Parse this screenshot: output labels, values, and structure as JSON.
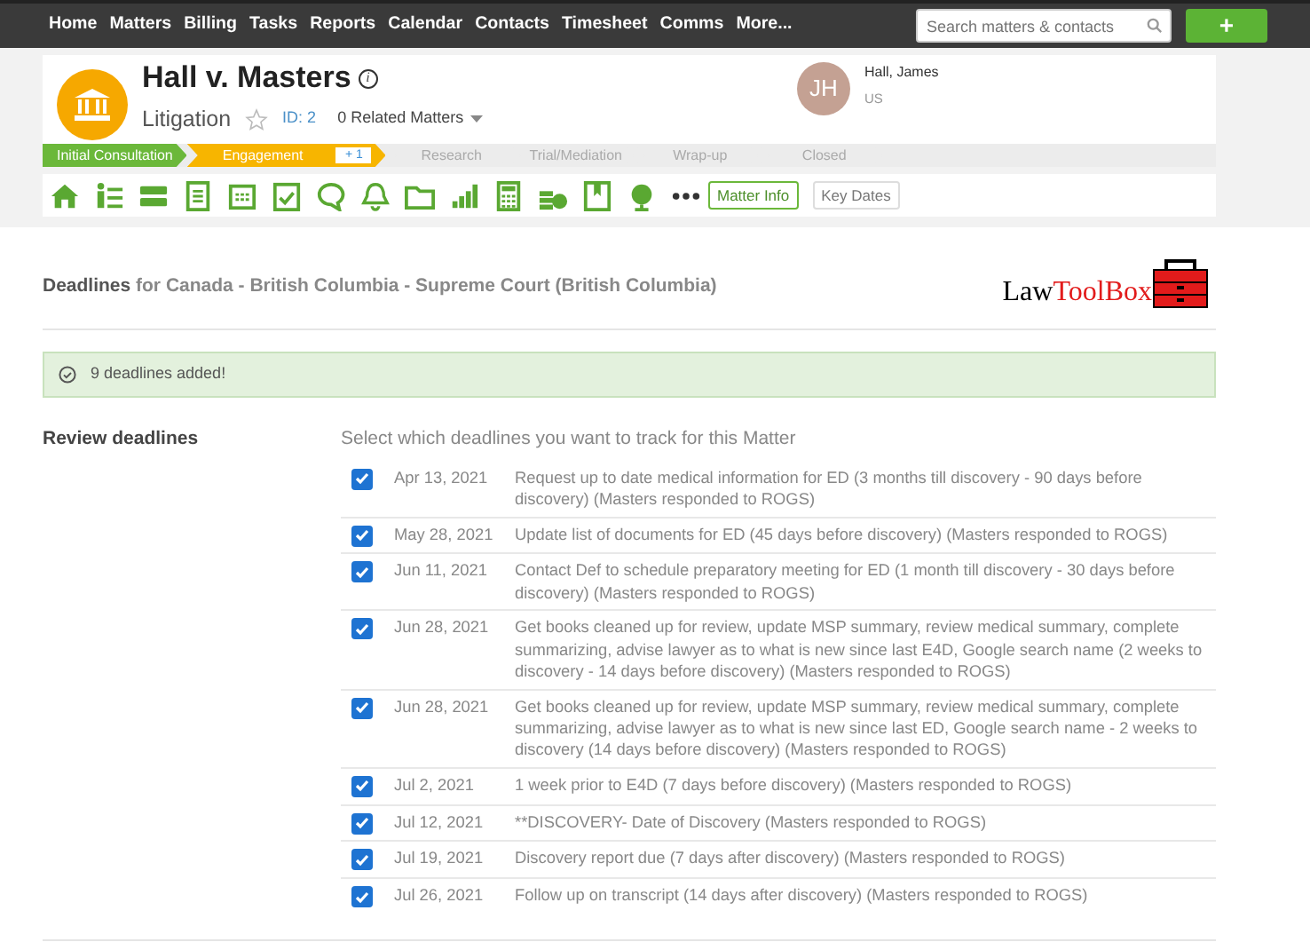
{
  "nav": {
    "items": [
      "Home",
      "Matters",
      "Billing",
      "Tasks",
      "Reports",
      "Calendar",
      "Contacts",
      "Timesheet",
      "Comms",
      "More..."
    ],
    "search": {
      "placeholder": "Search matters & contacts"
    },
    "add_button": "+"
  },
  "matter": {
    "title": "Hall v. Masters",
    "info_icon": "i",
    "type": "Litigation",
    "starred": false,
    "id": "ID: 2",
    "related": "0 Related Matters",
    "client": {
      "initials": "JH",
      "name": "Hall, James",
      "location": "US"
    },
    "stages": [
      {
        "label": "Initial Consultation",
        "completed": true,
        "selected": false
      },
      {
        "label": "Engagement",
        "completed": false,
        "selected": true,
        "badge": "+ 1"
      },
      {
        "label": "Research",
        "completed": false,
        "selected": false
      },
      {
        "label": "Trial/Mediation",
        "completed": false,
        "selected": false
      },
      {
        "label": "Wrap-up",
        "completed": false,
        "selected": false
      },
      {
        "label": "Closed",
        "completed": false,
        "selected": false
      }
    ],
    "tabs": [
      {
        "label": "Matter Info",
        "selected": true
      },
      {
        "label": "Key Dates",
        "selected": false
      }
    ]
  },
  "deadlines": {
    "heading": "Deadlines",
    "jurisdiction": "for Canada - British Columbia - Supreme Court (British Columbia)",
    "logo": {
      "first": "Law",
      "second": "ToolBox"
    },
    "alert": "9 deadlines added!",
    "review_label": "Review deadlines",
    "instructions": "Select which deadlines you want to track for this Matter",
    "rows": [
      {
        "checked": true,
        "date": "Apr 13, 2021",
        "text": "Request up to date medical information for ED (3 months till discovery - 90 days before discovery) (Masters responded to ROGS)"
      },
      {
        "checked": true,
        "date": "May 28, 2021",
        "text": "Update list of documents for ED (45 days before discovery) (Masters responded to ROGS)"
      },
      {
        "checked": true,
        "date": "Jun 11, 2021",
        "text": "Contact Def to schedule preparatory meeting for ED (1 month till discovery - 30 days before discovery) (Masters responded to ROGS)"
      },
      {
        "checked": true,
        "date": "Jun 28, 2021",
        "text": "Get books cleaned up for review, update MSP summary, review medical summary, complete summarizing, advise lawyer as to what is new since last E4D, Google search name (2 weeks to discovery - 14 days before discovery) (Masters responded to ROGS)"
      },
      {
        "checked": true,
        "date": "Jun 28, 2021",
        "text": "Get books cleaned up for review, update MSP summary, review medical summary, complete summarizing, advise lawyer as to what is new since last ED, Google search name - 2 weeks to discovery (14 days before discovery) (Masters responded to ROGS)"
      },
      {
        "checked": true,
        "date": "Jul 2, 2021",
        "text": "1 week prior to E4D (7 days before discovery) (Masters responded to ROGS)"
      },
      {
        "checked": true,
        "date": "Jul 12, 2021",
        "text": "**DISCOVERY- Date of Discovery (Masters responded to ROGS)"
      },
      {
        "checked": true,
        "date": "Jul 19, 2021",
        "text": "Discovery report due (7 days after discovery) (Masters responded to ROGS)"
      },
      {
        "checked": true,
        "date": "Jul 26, 2021",
        "text": "Follow up on transcript (14 days after discovery) (Masters responded to ROGS)"
      }
    ]
  }
}
